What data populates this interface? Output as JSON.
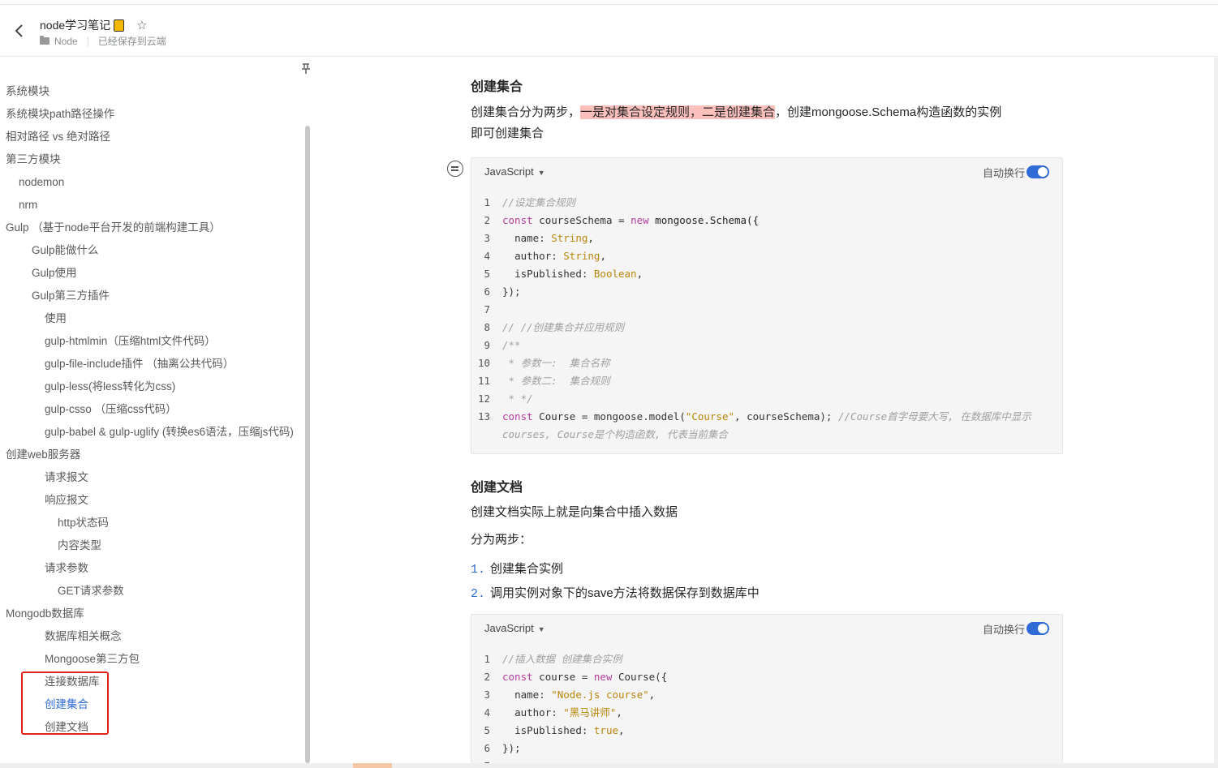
{
  "header": {
    "title": "node学习笔记",
    "title_icon": "notebook-emoji",
    "favorite_icon": "star-icon",
    "folder": "Node",
    "save_status": "已经保存到云端"
  },
  "sidebar": {
    "items": [
      {
        "label": "系统模块",
        "level": 0
      },
      {
        "label": "系统模块path路径操作",
        "level": 0
      },
      {
        "label": "相对路径 vs 绝对路径",
        "level": 0
      },
      {
        "label": "第三方模块",
        "level": 0
      },
      {
        "label": "nodemon",
        "level": 1
      },
      {
        "label": "nrm",
        "level": 1
      },
      {
        "label": "Gulp （基于node平台开发的前端构建工具）",
        "level": 0
      },
      {
        "label": "Gulp能做什么",
        "level": 2
      },
      {
        "label": "Gulp使用",
        "level": 2
      },
      {
        "label": "Gulp第三方插件",
        "level": 2
      },
      {
        "label": "使用",
        "level": 3
      },
      {
        "label": "gulp-htmlmin（压缩html文件代码）",
        "level": 3
      },
      {
        "label": "gulp-file-include插件 （抽离公共代码）",
        "level": 3
      },
      {
        "label": "gulp-less(将less转化为css)",
        "level": 3
      },
      {
        "label": "gulp-csso （压缩css代码）",
        "level": 3
      },
      {
        "label": "gulp-babel & gulp-uglify (转换es6语法，压缩js代码)",
        "level": 3
      },
      {
        "label": "创建web服务器",
        "level": 0
      },
      {
        "label": "请求报文",
        "level": 3
      },
      {
        "label": "响应报文",
        "level": 3
      },
      {
        "label": "http状态码",
        "level": 4
      },
      {
        "label": "内容类型",
        "level": 4
      },
      {
        "label": "请求参数",
        "level": 3
      },
      {
        "label": "GET请求参数",
        "level": 4
      },
      {
        "label": "Mongodb数据库",
        "level": 0
      },
      {
        "label": "数据库相关概念",
        "level": 3
      },
      {
        "label": "Mongoose第三方包",
        "level": 3
      },
      {
        "label": "连接数据库",
        "level": 3
      },
      {
        "label": "创建集合",
        "level": 3,
        "active": true
      },
      {
        "label": "创建文档",
        "level": 3
      }
    ]
  },
  "main": {
    "section1_title": "创建集合",
    "section1_p_before": "创建集合分为两步，",
    "section1_p_mark": "一是对集合设定规则，二是创建集合",
    "section1_p_after": "，创建mongoose.Schema构造函数的实例",
    "section1_p_line2": "即可创建集合",
    "section2_title": "创建文档",
    "section2_p1": "创建文档实际上就是向集合中插入数据",
    "section2_p2": "分为两步：",
    "list": [
      {
        "num": "1.",
        "text": "创建集合实例"
      },
      {
        "num": "2.",
        "text": "调用实例对象下的save方法将数据保存到数据库中"
      }
    ]
  },
  "code_blocks": [
    {
      "language": "JavaScript",
      "wrap_label": "自动换行",
      "wrap_on": true,
      "lines": [
        {
          "n": "1",
          "parts": [
            {
              "t": "//设定集合规则",
              "c": "cm"
            }
          ]
        },
        {
          "n": "2",
          "parts": [
            {
              "t": "const",
              "c": "kw"
            },
            {
              "t": " courseSchema = ",
              "c": ""
            },
            {
              "t": "new",
              "c": "kw"
            },
            {
              "t": " mongoose.Schema({",
              "c": "fn"
            }
          ]
        },
        {
          "n": "3",
          "parts": [
            {
              "t": "  name: ",
              "c": ""
            },
            {
              "t": "String",
              "c": "str"
            },
            {
              "t": ",",
              "c": ""
            }
          ]
        },
        {
          "n": "4",
          "parts": [
            {
              "t": "  author: ",
              "c": ""
            },
            {
              "t": "String",
              "c": "str"
            },
            {
              "t": ",",
              "c": ""
            }
          ]
        },
        {
          "n": "5",
          "parts": [
            {
              "t": "  isPublished: ",
              "c": ""
            },
            {
              "t": "Boolean",
              "c": "str"
            },
            {
              "t": ",",
              "c": ""
            }
          ]
        },
        {
          "n": "6",
          "parts": [
            {
              "t": "});",
              "c": ""
            }
          ]
        },
        {
          "n": "7",
          "parts": [
            {
              "t": "",
              "c": ""
            }
          ]
        },
        {
          "n": "8",
          "parts": [
            {
              "t": "// //创建集合并应用规则",
              "c": "cm"
            }
          ]
        },
        {
          "n": "9",
          "parts": [
            {
              "t": "/**",
              "c": "cm"
            }
          ]
        },
        {
          "n": "10",
          "parts": [
            {
              "t": " * 参数一:  集合名称",
              "c": "cm"
            }
          ]
        },
        {
          "n": "11",
          "parts": [
            {
              "t": " * 参数二:  集合规则",
              "c": "cm"
            }
          ]
        },
        {
          "n": "12",
          "parts": [
            {
              "t": " * */",
              "c": "cm"
            }
          ]
        },
        {
          "n": "13",
          "parts": [
            {
              "t": "const",
              "c": "kw"
            },
            {
              "t": " Course = mongoose.model(",
              "c": ""
            },
            {
              "t": "\"Course\"",
              "c": "str"
            },
            {
              "t": ", courseSchema); ",
              "c": ""
            },
            {
              "t": "//Course首字母要大写, 在数据库中显示courses, Course是个构造函数, 代表当前集合",
              "c": "cm"
            }
          ]
        }
      ]
    },
    {
      "language": "JavaScript",
      "wrap_label": "自动换行",
      "wrap_on": true,
      "lines": [
        {
          "n": "1",
          "parts": [
            {
              "t": "//插入数据 创建集合实例",
              "c": "cm"
            }
          ]
        },
        {
          "n": "2",
          "parts": [
            {
              "t": "const",
              "c": "kw"
            },
            {
              "t": " course = ",
              "c": ""
            },
            {
              "t": "new",
              "c": "kw"
            },
            {
              "t": " Course({",
              "c": ""
            }
          ]
        },
        {
          "n": "3",
          "parts": [
            {
              "t": "  name: ",
              "c": ""
            },
            {
              "t": "\"Node.js course\"",
              "c": "str"
            },
            {
              "t": ",",
              "c": ""
            }
          ]
        },
        {
          "n": "4",
          "parts": [
            {
              "t": "  author: ",
              "c": ""
            },
            {
              "t": "\"黑马讲师\"",
              "c": "str"
            },
            {
              "t": ",",
              "c": ""
            }
          ]
        },
        {
          "n": "5",
          "parts": [
            {
              "t": "  isPublished: ",
              "c": ""
            },
            {
              "t": "true",
              "c": "str"
            },
            {
              "t": ",",
              "c": ""
            }
          ]
        },
        {
          "n": "6",
          "parts": [
            {
              "t": "});",
              "c": ""
            }
          ]
        },
        {
          "n": "7",
          "parts": [
            {
              "t": "",
              "c": ""
            }
          ]
        }
      ]
    }
  ],
  "colors": {
    "accent": "#2f6bd6",
    "highlight": "#fbbfbc",
    "annotation_box": "#e0211c"
  }
}
